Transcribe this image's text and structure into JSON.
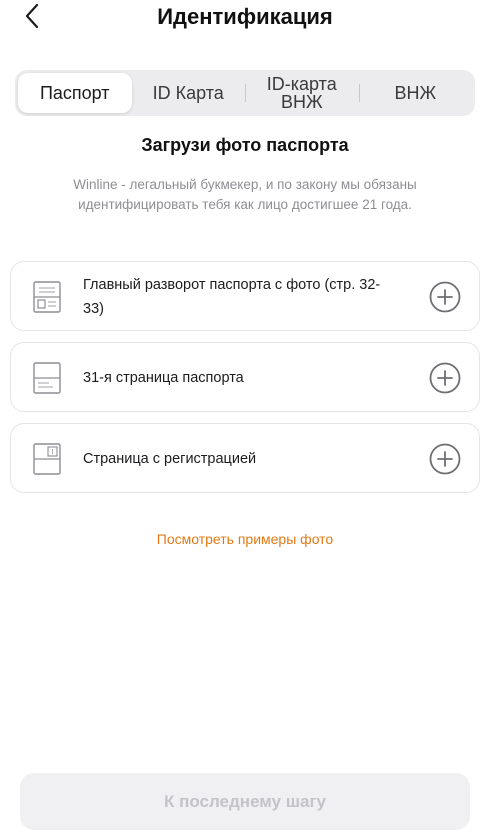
{
  "header": {
    "title": "Идентификация",
    "back_icon": "chevron-left-icon"
  },
  "tabs": [
    {
      "label": "Паспорт",
      "active": true
    },
    {
      "label": "ID Карта",
      "active": false
    },
    {
      "label": "ID-карта ВНЖ",
      "active": false
    },
    {
      "label": "ВНЖ",
      "active": false
    }
  ],
  "section": {
    "title": "Загрузи фото паспорта",
    "description": "Winline - легальный букмекер, и по закону мы обязаны идентифицировать тебя как лицо достигшее 21 года."
  },
  "documents": [
    {
      "label": "Главный разворот паспорта с фото (стр. 32-33)",
      "icon": "passport-photo-page-icon",
      "action_icon": "add-circle-icon"
    },
    {
      "label": "31-я страница паспорта",
      "icon": "passport-page-icon",
      "action_icon": "add-circle-icon"
    },
    {
      "label": "Страница с регистрацией",
      "icon": "registration-page-icon",
      "action_icon": "add-circle-icon"
    }
  ],
  "examples_link": "Посмотреть примеры фото",
  "submit_button": {
    "label": "К последнему шагу",
    "enabled": false
  },
  "colors": {
    "accent": "#e07a16",
    "muted_text": "#8e8e93",
    "disabled_button_bg": "#f0f0f2",
    "disabled_button_text": "#c4c4c8"
  }
}
